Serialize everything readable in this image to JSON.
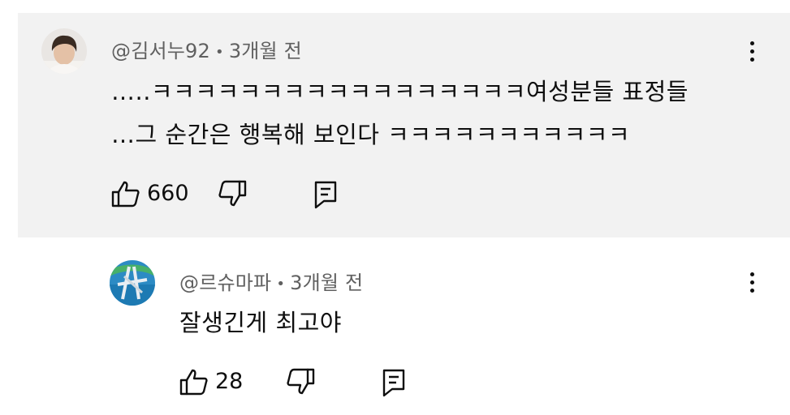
{
  "comments": [
    {
      "handle": "@김서누92",
      "time": "3개월 전",
      "lines": [
        "…..ㅋㅋㅋㅋㅋㅋㅋㅋㅋㅋㅋㅋㅋㅋㅋㅋㅋ여성분들 표정들",
        "…그 순간은 행복해 보인다 ㅋㅋㅋㅋㅋㅋㅋㅋㅋㅋㅋ"
      ],
      "likes": "660"
    },
    {
      "handle": "@르슈마파",
      "time": "3개월 전",
      "lines": [
        "잘생긴게 최고야"
      ],
      "likes": "28"
    }
  ],
  "separator": "•",
  "colors": {
    "highlight_bg": "#f2f2f2",
    "meta_text": "#606060",
    "text": "#0f0f0f"
  },
  "icons": [
    "thumbs-up-icon",
    "thumbs-down-icon",
    "reply-icon",
    "more-vert-icon"
  ]
}
